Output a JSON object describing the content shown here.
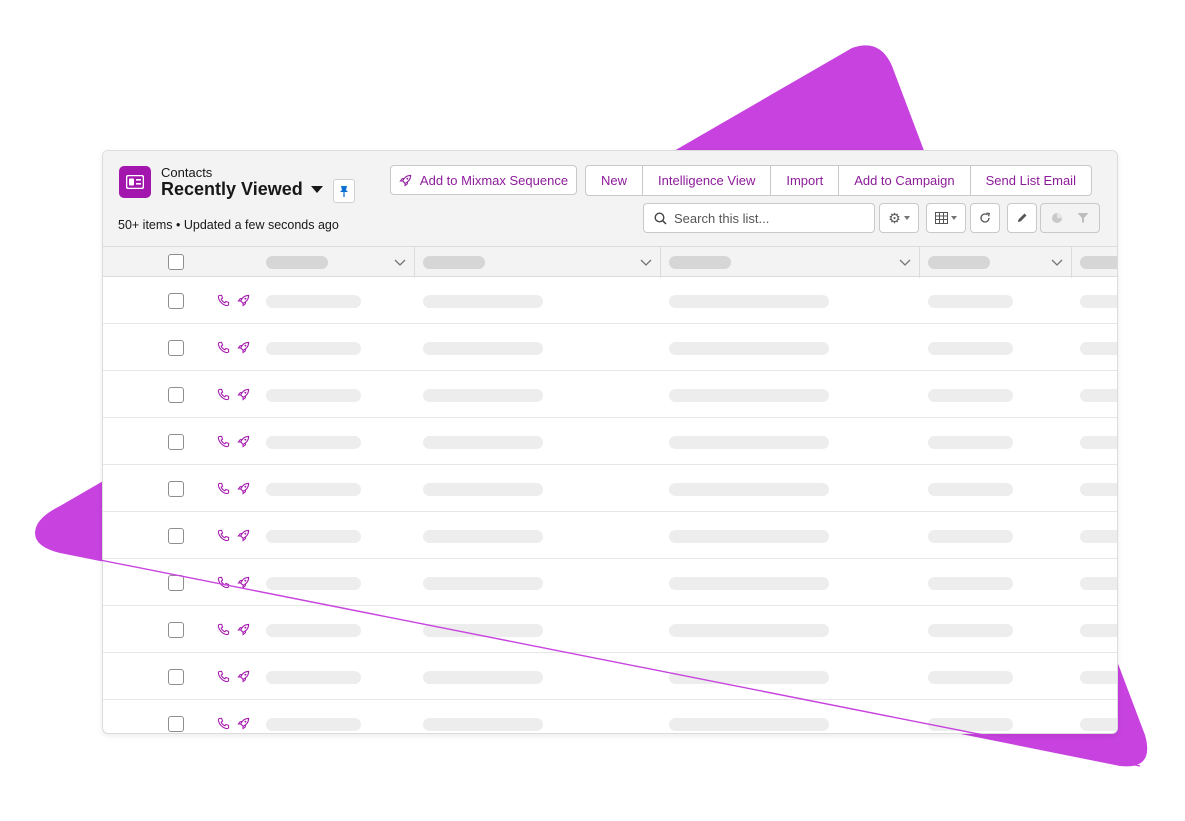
{
  "colors": {
    "brand": "#a316ad",
    "accent_text": "#8d1c9a",
    "background_shape": "#c742df",
    "placeholder_pill": "#ededed"
  },
  "header": {
    "object_icon": "contact-card-icon",
    "object_label": "Contacts",
    "list_view_name": "Recently Viewed",
    "meta": "50+ items • Updated a few seconds ago"
  },
  "actions": {
    "mixmax_button": "Add to Mixmax Sequence",
    "group": [
      {
        "label": "New",
        "name": "new-button"
      },
      {
        "label": "Intelligence View",
        "name": "intelligence-view-button"
      },
      {
        "label": "Import",
        "name": "import-button"
      },
      {
        "label": "Add to Campaign",
        "name": "add-to-campaign-button"
      },
      {
        "label": "Send List Email",
        "name": "send-list-email-button"
      }
    ]
  },
  "search": {
    "placeholder": "Search this list...",
    "value": ""
  },
  "toolbar": {
    "icons": [
      "gear-icon",
      "table-view-icon",
      "refresh-icon",
      "pencil-icon",
      "chart-icon",
      "filter-icon"
    ]
  },
  "table": {
    "row_count_visible": 10,
    "row_action_icons": [
      "phone-icon",
      "rocket-icon"
    ]
  }
}
